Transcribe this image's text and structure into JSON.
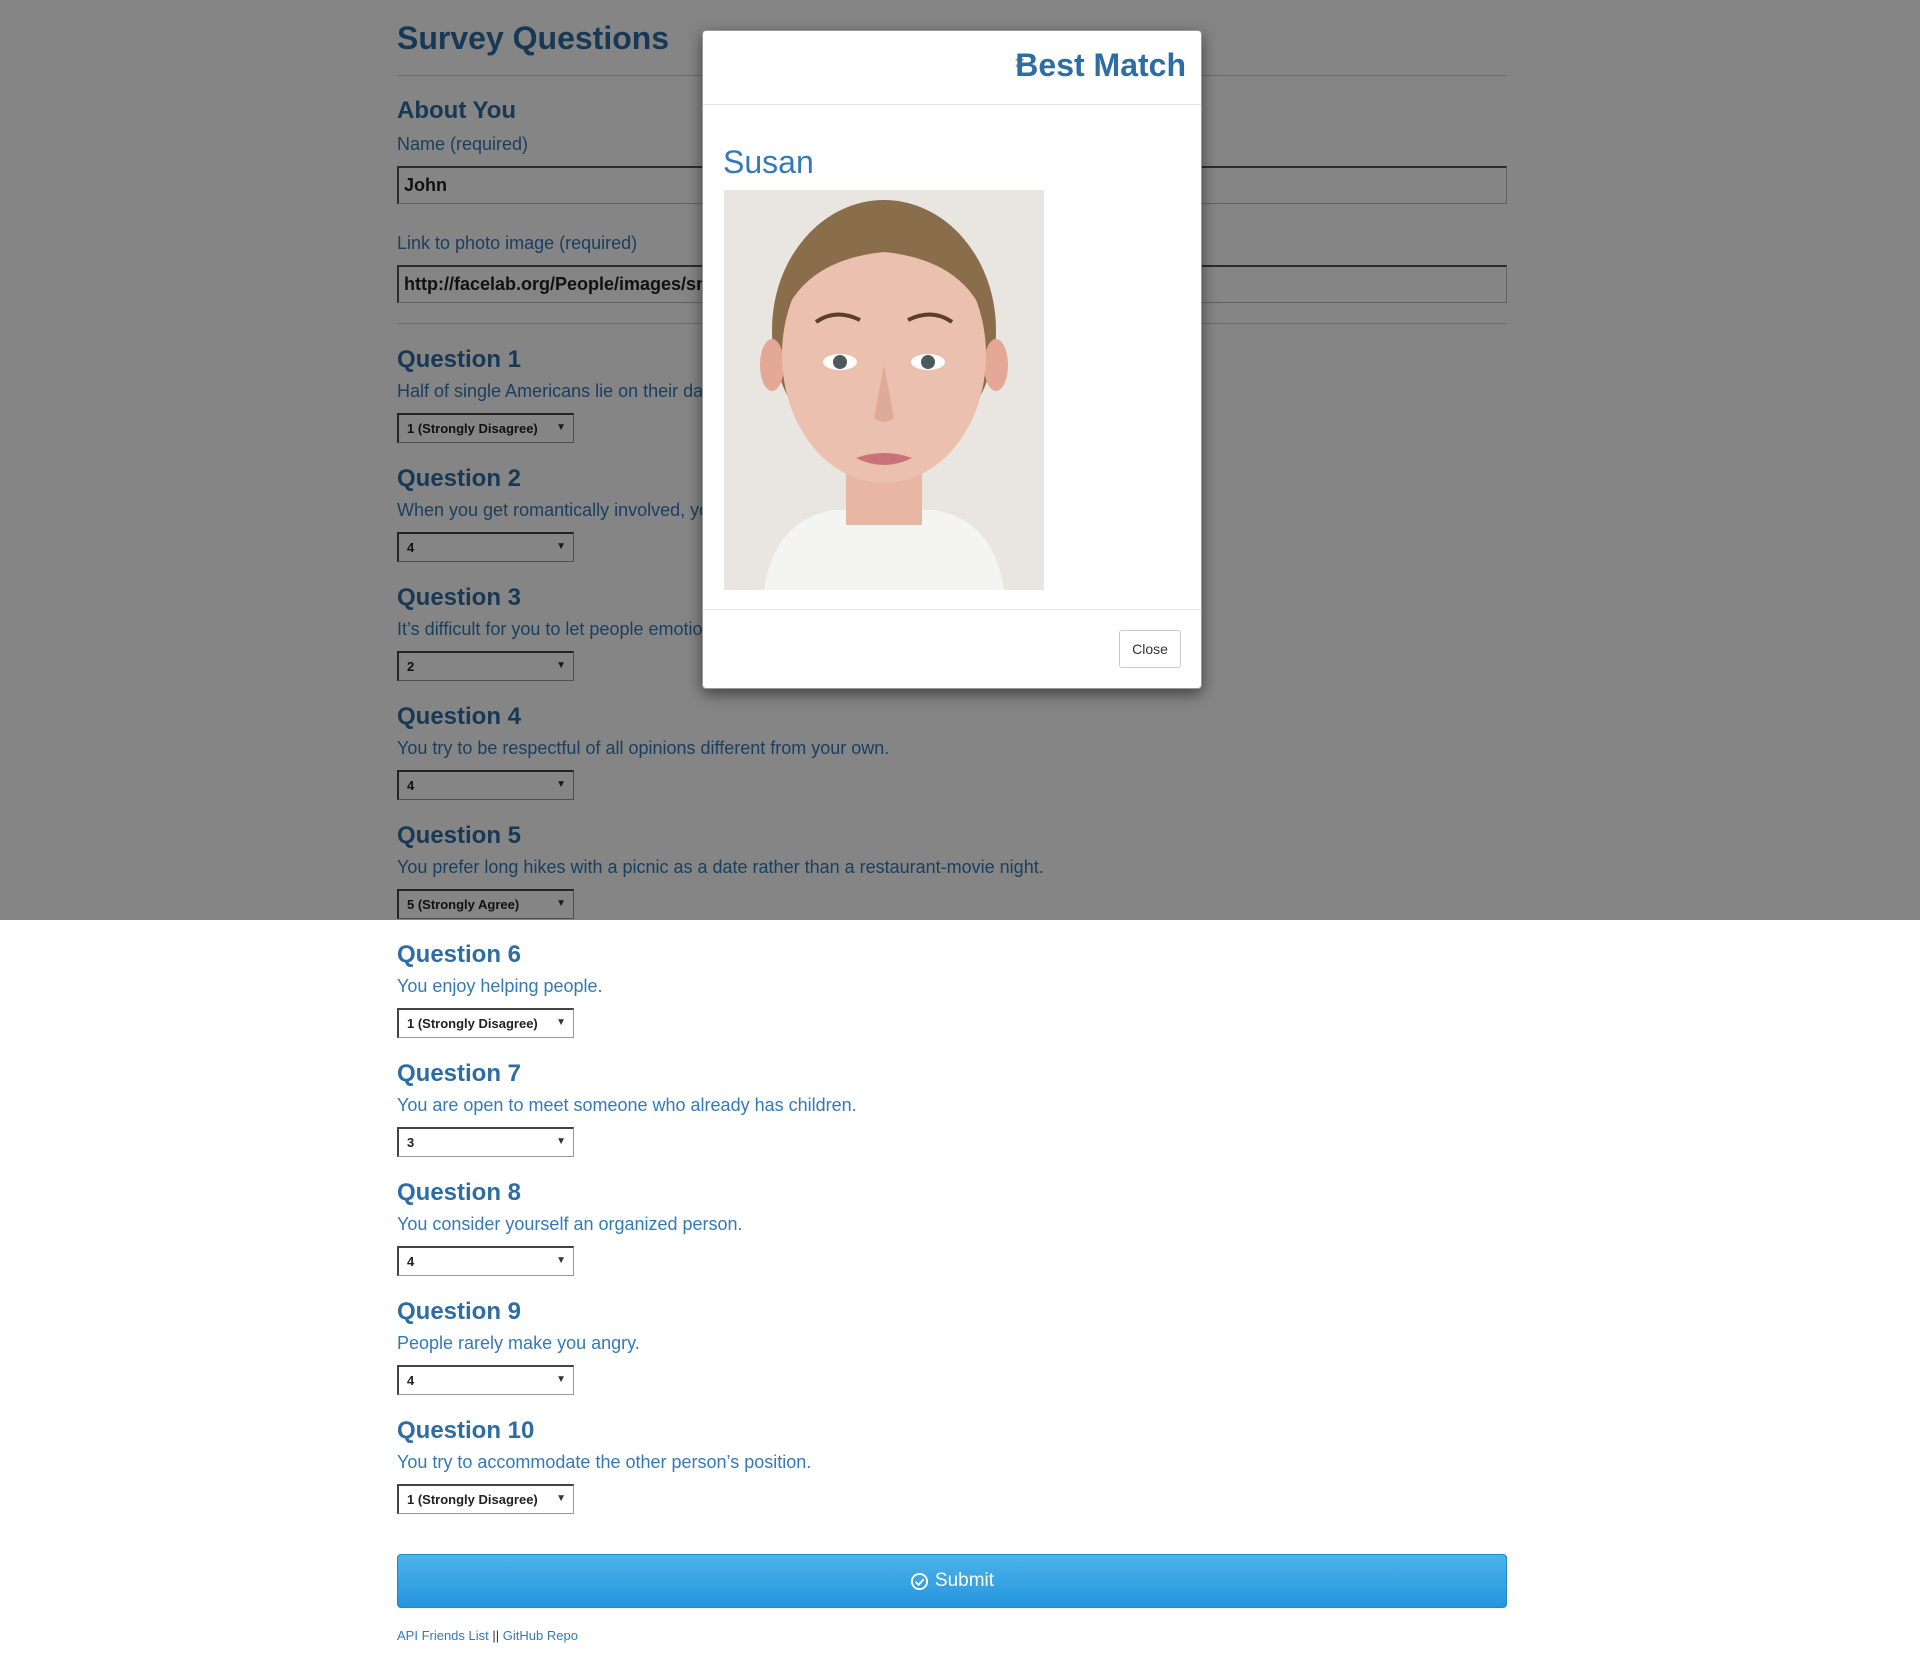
{
  "page": {
    "title": "Survey Questions",
    "about_title": "About You",
    "name_label": "Name (required)",
    "name_value": "John",
    "photo_label": "Link to photo image (required)",
    "photo_value": "http://facelab.org/People/images/sm"
  },
  "questions": [
    {
      "title": "Question 1",
      "text": "Half of single Americans lie on their da",
      "selected": "1 (Strongly Disagree)"
    },
    {
      "title": "Question 2",
      "text": "When you get romantically involved, yo",
      "selected": "4"
    },
    {
      "title": "Question 3",
      "text": "It’s difficult for you to let people emotio",
      "selected": "2"
    },
    {
      "title": "Question 4",
      "text": "You try to be respectful of all opinions different from your own.",
      "selected": "4"
    },
    {
      "title": "Question 5",
      "text": "You prefer long hikes with a picnic as a date rather than a restaurant-movie night.",
      "selected": "5 (Strongly Agree)"
    },
    {
      "title": "Question 6",
      "text": "You enjoy helping people.",
      "selected": "1 (Strongly Disagree)"
    },
    {
      "title": "Question 7",
      "text": "You are open to meet someone who already has children.",
      "selected": "3"
    },
    {
      "title": "Question 8",
      "text": "You consider yourself an organized person.",
      "selected": "4"
    },
    {
      "title": "Question 9",
      "text": "People rarely make you angry.",
      "selected": "4"
    },
    {
      "title": "Question 10",
      "text": "You try to accommodate the other person’s position.",
      "selected": "1 (Strongly Disagree)"
    }
  ],
  "submit": {
    "label": "Submit",
    "icon": "check-circle-icon"
  },
  "footer": {
    "link1": "API Friends List",
    "separator": "||",
    "link2": "GitHub Repo"
  },
  "modal": {
    "close_x": "×",
    "title": "Best Match",
    "match_name": "Susan",
    "close_label": "Close"
  },
  "colors": {
    "primary": "#337ab7",
    "heading": "#2e6da4",
    "submit": "#2496de"
  }
}
